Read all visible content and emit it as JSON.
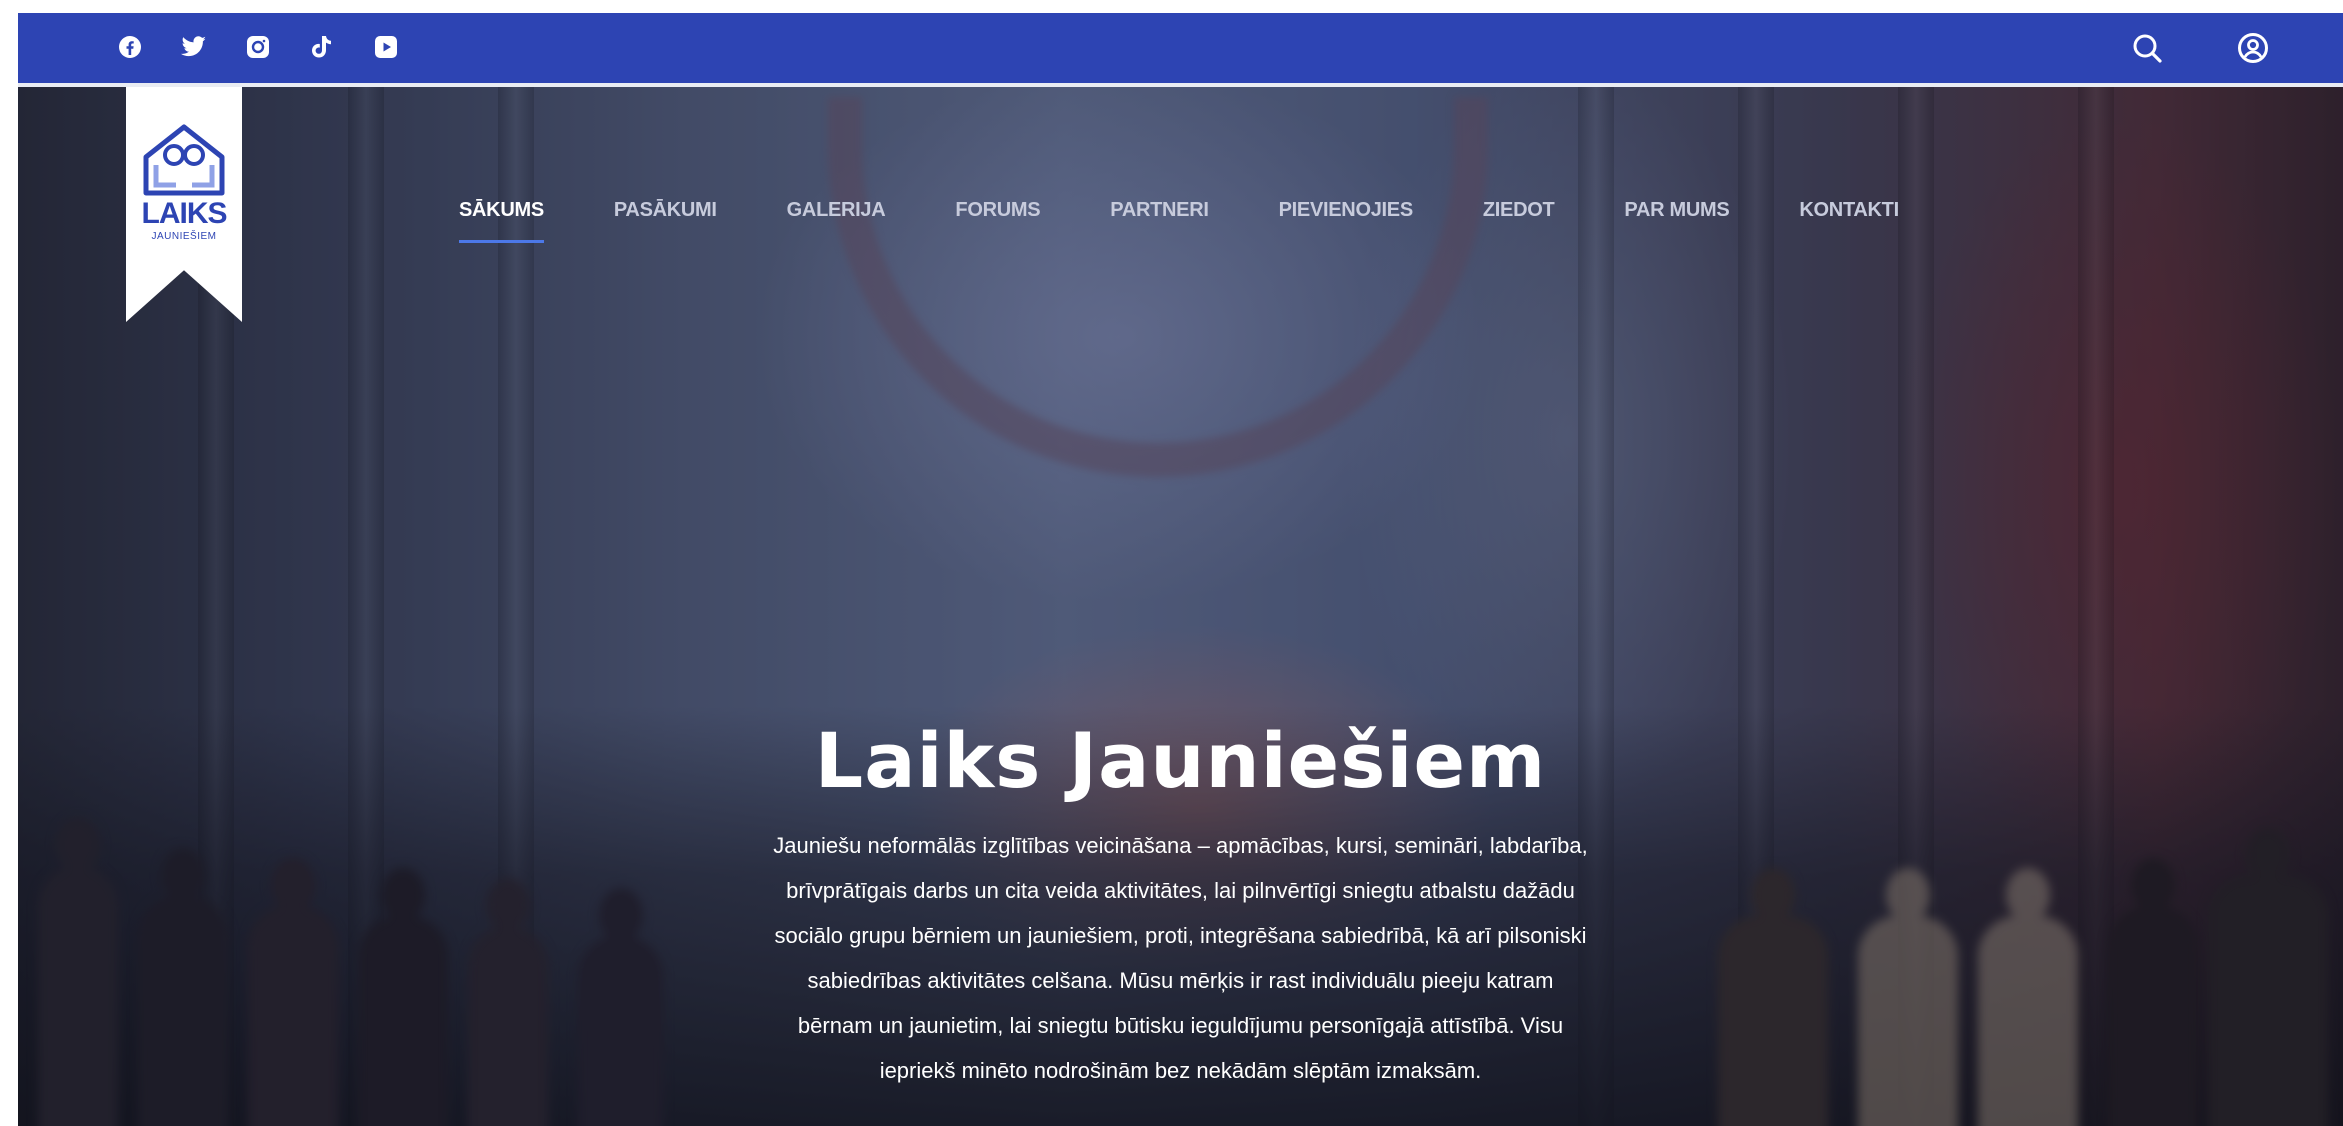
{
  "colors": {
    "topbar": "#2d44b3",
    "active_underline": "#4c78e8",
    "nav_text": "#c7cbdc",
    "hero_text": "#ffffff"
  },
  "topbar": {
    "social_icons": [
      "facebook-icon",
      "twitter-icon",
      "instagram-icon",
      "tiktok-icon",
      "youtube-icon"
    ],
    "tool_icons": [
      "search-icon",
      "user-account-icon"
    ]
  },
  "logo": {
    "word": "LAIKS",
    "sub": "JAUNIEŠIEM"
  },
  "nav": {
    "items": [
      {
        "label": "SĀKUMS",
        "active": true
      },
      {
        "label": "PASĀKUMI",
        "active": false
      },
      {
        "label": "GALERIJA",
        "active": false
      },
      {
        "label": "FORUMS",
        "active": false
      },
      {
        "label": "PARTNERI",
        "active": false
      },
      {
        "label": "PIEVIENOJIES",
        "active": false
      },
      {
        "label": "ZIEDOT",
        "active": false
      },
      {
        "label": "PAR MUMS",
        "active": false
      },
      {
        "label": "KONTAKTI",
        "active": false
      }
    ]
  },
  "hero": {
    "title": "Laiks Jauniešiem",
    "lines": [
      "Jauniešu neformālās izglītības veicināšana – apmācības, kursi, semināri, labdarība,",
      "brīvprātīgais darbs un cita veida aktivitātes, lai pilnvērtīgi sniegtu atbalstu dažādu",
      "sociālo grupu bērniem un jauniešiem, proti, integrēšana sabiedrībā, kā arī pilsoniski",
      "sabiedrības aktivitātes celšana. Mūsu mērķis ir rast individuālu pieeju katram",
      "bērnam un jaunietim, lai sniegtu būtisku ieguldījumu personīgajā attīstībā. Visu",
      "iepriekš minēto nodrošinām bez nekādām slēptām izmaksām."
    ]
  }
}
